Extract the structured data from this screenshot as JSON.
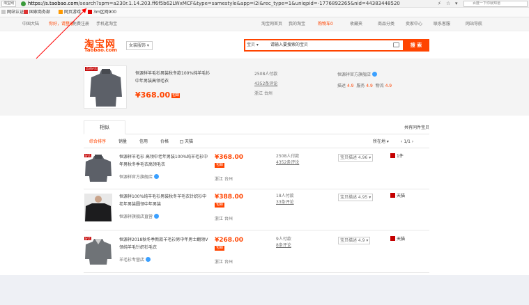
{
  "browser": {
    "site_button": "淘宝网",
    "url_host": "https://s.taobao.com",
    "url_rest": "/search?spm=a230r.1.14.203.ff6f5b62LWxMCF&type=samestyle&app=i2i&rec_type=1&uniqpid=-1776892265&nid=44383448520",
    "search_placeholder": "百度一下你就知道"
  },
  "bookmarks": [
    {
      "label": "网站认证",
      "color": "#c8c8c8"
    },
    {
      "label": "国家商务部",
      "color": "#d33"
    },
    {
      "label": "网页游戏",
      "color": "#f90"
    },
    {
      "label": "3m区网900",
      "color": "#d00"
    }
  ],
  "topnav": {
    "region": "中国大陆",
    "greeting": "你好，请登录",
    "register": "免费注册",
    "mobile": "手机逛淘宝",
    "links": [
      "淘宝网首页",
      "我的淘宝",
      "购物车0",
      "收藏夹",
      "商品分类",
      "卖家中心",
      "联系客服",
      "网站导航"
    ]
  },
  "header": {
    "logo_cn": "淘宝网",
    "logo_en": "Taobao.com",
    "category": "女装服饰",
    "search_tab": "宝贝",
    "search_query": "请输入要搜索的宝贝",
    "search_button": "搜 索"
  },
  "product": {
    "tag": "品质好货",
    "title": "恒源祥羊毛衫男装秋冬款100%纯羊毛衫中年男装高领毛衣",
    "price": "¥368.00",
    "price_badge": "包邮",
    "sales": "2508人付款",
    "comments": "4352条评论",
    "location": "浙江 台州",
    "shop_name": "恒源祥官方旗舰店",
    "ratings": [
      {
        "label": "描述",
        "value": "4.9"
      },
      {
        "label": "服务",
        "value": "4.9"
      },
      {
        "label": "物流",
        "value": "4.9"
      }
    ]
  },
  "tabs": {
    "active": "相似",
    "right_link": "共有同件宝贝"
  },
  "sortbar": {
    "items": [
      "综合排序",
      "销量",
      "信用",
      "价格"
    ],
    "checkbox_label": "天猫",
    "location_filter": "所在地",
    "pager": "1/1"
  },
  "results": [
    {
      "tag": "好货",
      "title": "恒源祥羊毛衫 高领中老年男装100%纯羊毛衫中年男秋冬季毛衣高领毛衣",
      "shop": "恒源祥官方旗舰店",
      "price": "¥368.00",
      "badge": "包邮",
      "location": "浙江 台州",
      "sales": "2508人付款",
      "comments": "4352条评论",
      "compare": "宝贝描述 4.96",
      "tmall": "1件"
    },
    {
      "tag": "",
      "title": "恒源祥100%纯羊毛衫男装秋冬羊毛衣针织衫中老年男装圆领中年男装",
      "shop": "恒源祥旗舰店直营",
      "price": "¥388.00",
      "badge": "包邮",
      "location": "浙江 台州",
      "sales": "18人付款",
      "comments": "33条评论",
      "compare": "宝贝描述 4.95",
      "tmall": "天猫"
    },
    {
      "tag": "好货",
      "title": "恒源祥2018秋冬季新款羊毛衫男中年男士翻领V领纯羊毛针织衫毛衣",
      "shop": "羊毛衫专营店",
      "price": "¥268.00",
      "badge": "包邮",
      "location": "浙江 台州",
      "sales": "9人付款",
      "comments": "8条评论",
      "compare": "宝贝描述 4.9",
      "tmall": "天猫"
    }
  ],
  "colors": {
    "accent": "#ff4400",
    "annotation": "#ff0000"
  }
}
